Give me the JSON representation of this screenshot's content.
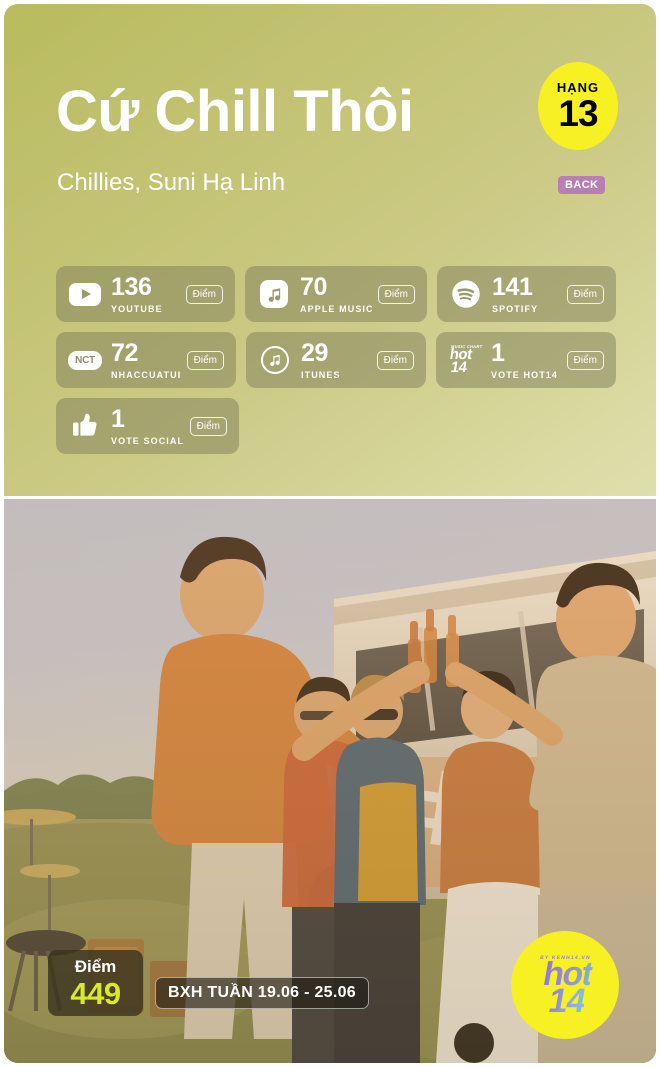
{
  "header": {
    "title": "Cứ Chill Thôi",
    "artists": "Chillies, Suni Hạ Linh",
    "rank_label": "HẠNG",
    "rank_value": "13",
    "back_badge": "BACK",
    "badge_color": "#f7f022",
    "back_color": "#b77fb2"
  },
  "stats": [
    {
      "icon": "youtube-icon",
      "value": "136",
      "platform": "YOUTUBE",
      "unit": "Điểm"
    },
    {
      "icon": "apple-music-icon",
      "value": "70",
      "platform": "APPLE MUSIC",
      "unit": "Điểm"
    },
    {
      "icon": "spotify-icon",
      "value": "141",
      "platform": "SPOTIFY",
      "unit": "Điểm"
    },
    {
      "icon": "nhaccuatui-icon",
      "value": "72",
      "platform": "NHACCUATUI",
      "unit": "Điểm"
    },
    {
      "icon": "itunes-icon",
      "value": "29",
      "platform": "ITUNES",
      "unit": "Điểm"
    },
    {
      "icon": "hot14-icon",
      "value": "1",
      "platform": "VOTE HOT14",
      "unit": "Điểm"
    },
    {
      "icon": "thumbs-up-icon",
      "value": "1",
      "platform": "VOTE SOCIAL",
      "unit": "Điểm"
    }
  ],
  "nct_logo_text": "NCT",
  "hot14_card_logo": {
    "tiny": "MUSIC CHART",
    "top": "hot",
    "bottom": "14"
  },
  "footer": {
    "score_label": "Điểm",
    "score_value": "449",
    "week_label": "BXH TUẦN 19.06 - 25.06",
    "score_accent": "#d6ec27"
  },
  "watermark": {
    "tiny": "BY KENH14.VN",
    "top": "hot",
    "bottom": "14",
    "bg": "#f7f022"
  }
}
